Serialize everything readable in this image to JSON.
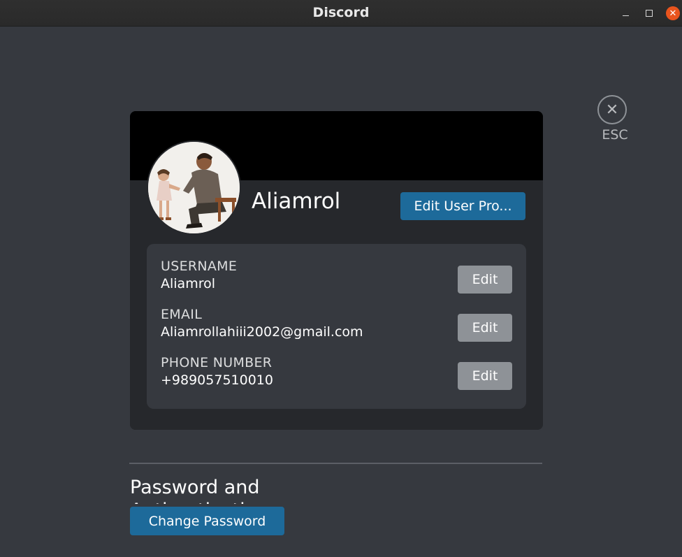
{
  "window": {
    "title": "Discord",
    "minimize_icon": "minimize-icon",
    "maximize_icon": "maximize-icon",
    "close_glyph": "✕"
  },
  "close_settings": {
    "glyph": "✕",
    "label": "ESC"
  },
  "profile": {
    "display_name": "Aliamrol",
    "edit_profile_label": "Edit User Pro...",
    "avatar_icon": "user-avatar-photo",
    "banner_color": "#000000"
  },
  "fields": [
    {
      "label": "USERNAME",
      "value": "Aliamrol",
      "edit_label": "Edit"
    },
    {
      "label": "EMAIL",
      "value": "Aliamrollahiii2002@gmail.com",
      "edit_label": "Edit"
    },
    {
      "label": "PHONE NUMBER",
      "value": "+989057510010",
      "edit_label": "Edit"
    }
  ],
  "security": {
    "section_title": "Password and Authentication",
    "change_password_label": "Change Password"
  },
  "colors": {
    "background": "#36393f",
    "card": "#26282c",
    "accent": "#1d6a9a",
    "edit_button": "#8e9297",
    "close_button": "#e9541d"
  }
}
